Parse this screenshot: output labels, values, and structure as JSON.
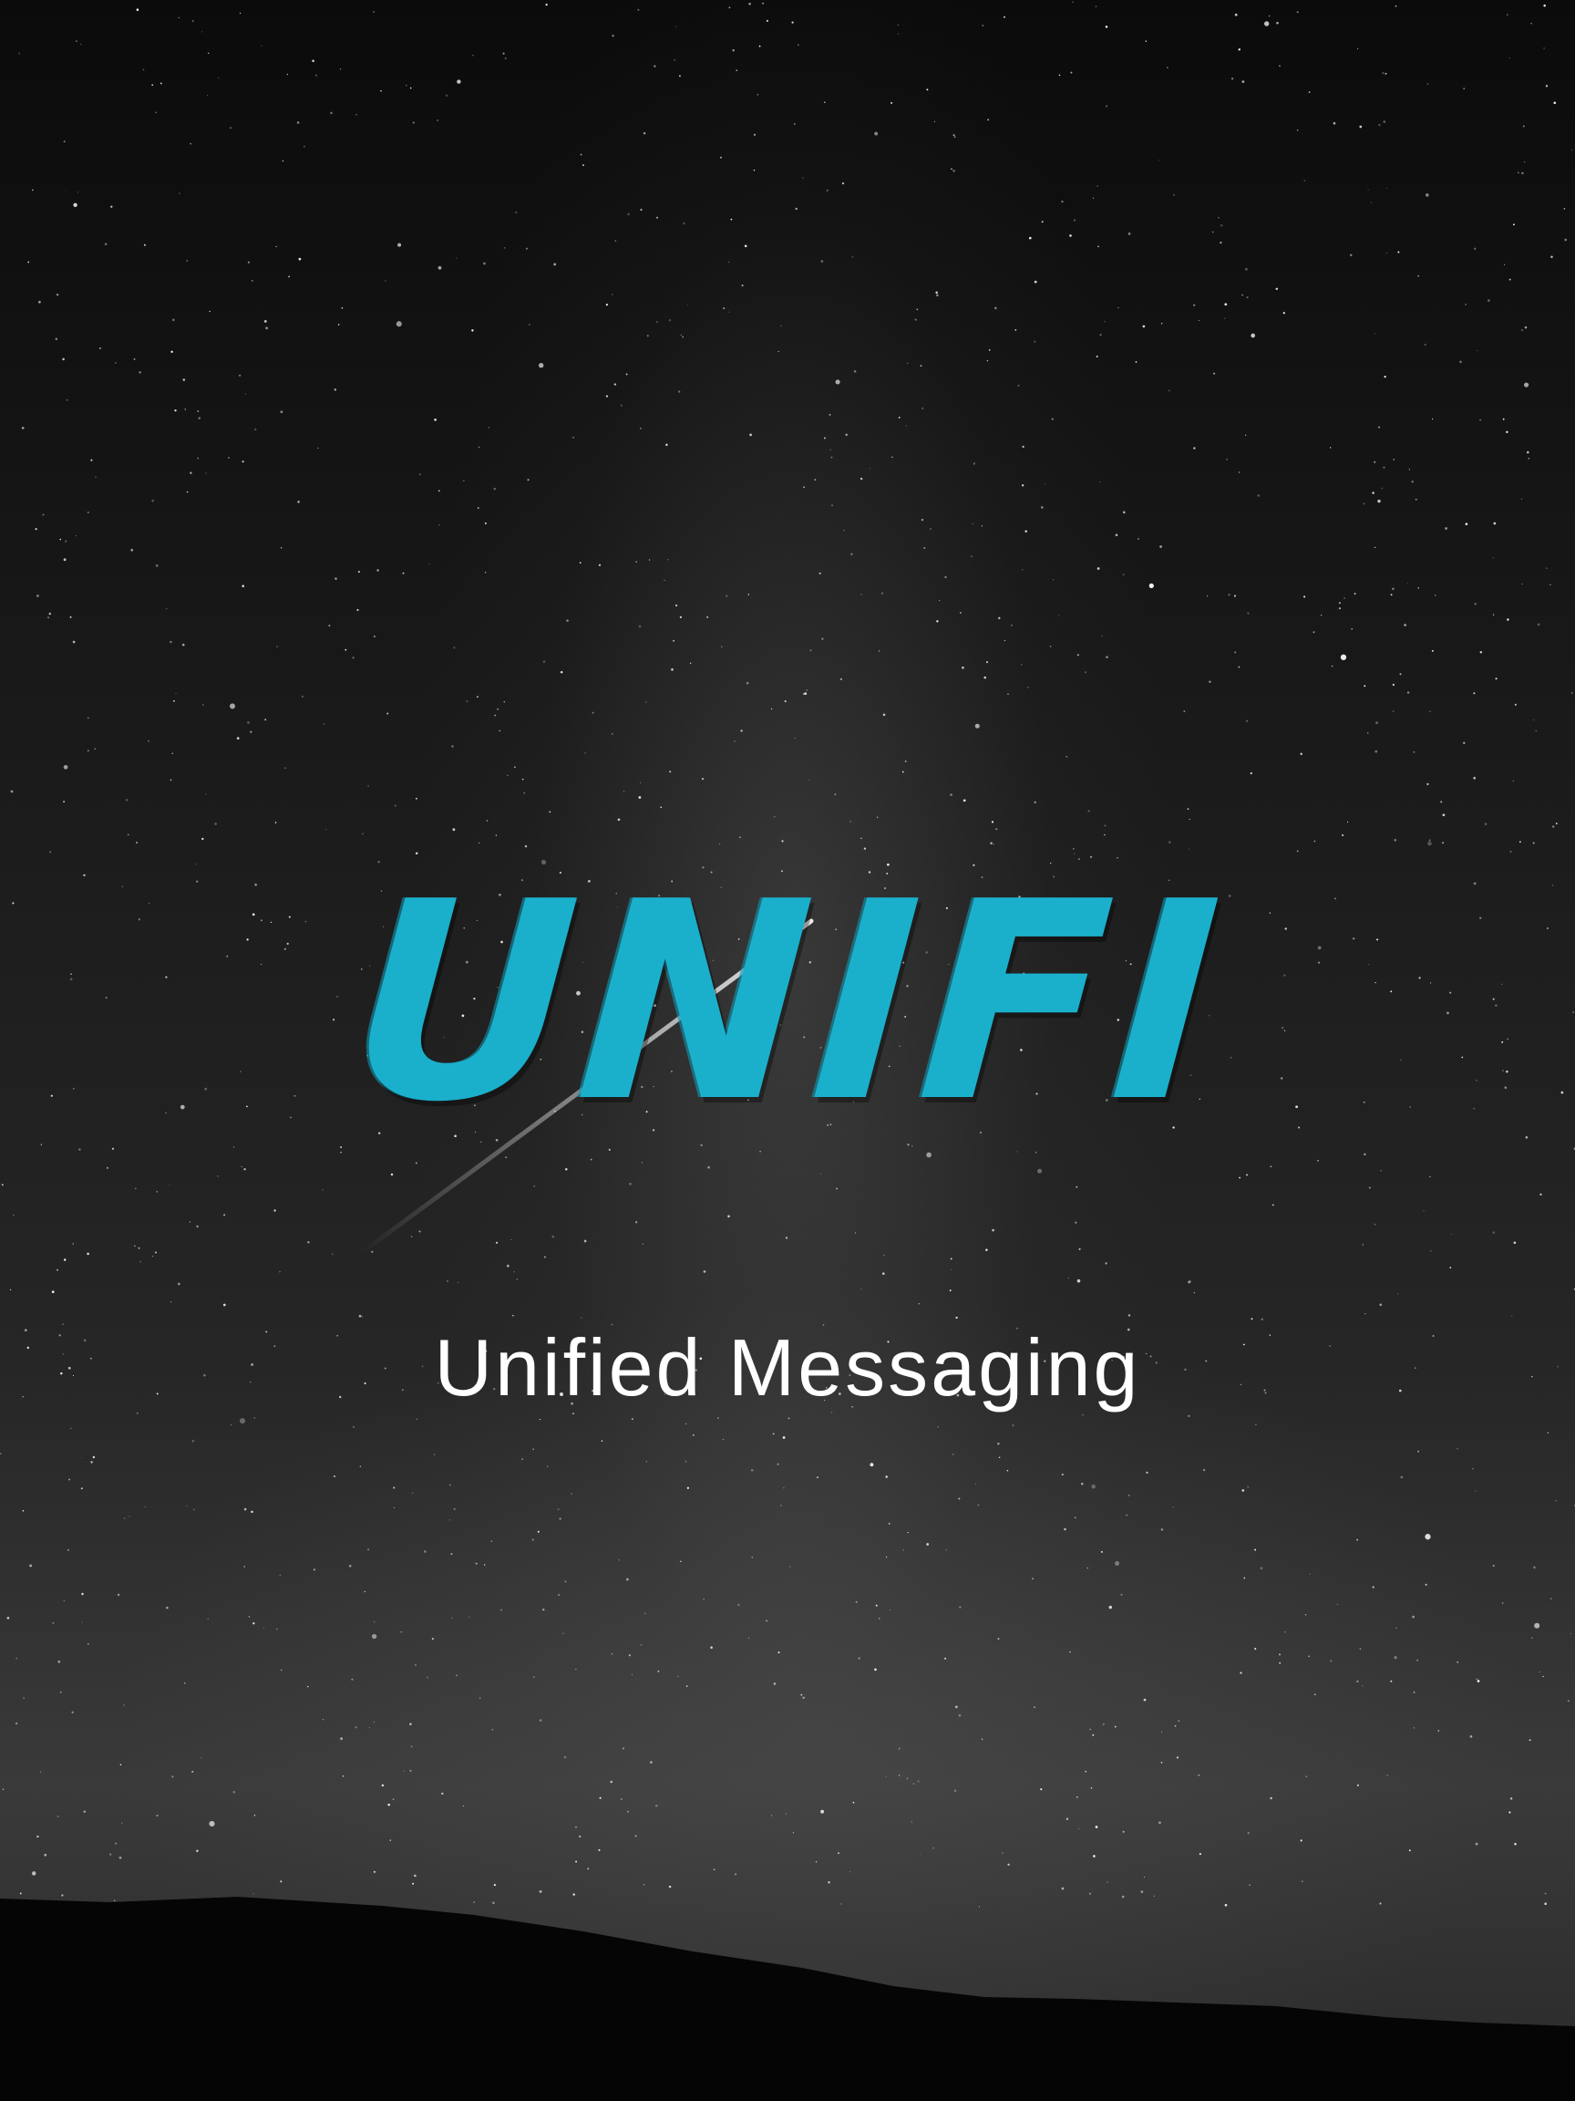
{
  "splash": {
    "logo_text": "UNIFI",
    "tagline": "Unified Messaging"
  },
  "colors": {
    "logo": "#1ab0cc",
    "tagline": "#ffffff",
    "sky_dark": "#0b0b0b",
    "horizon": "#050505"
  },
  "background": {
    "type": "night-sky-with-milky-way",
    "elements": [
      "stars",
      "meteor",
      "mountain-silhouette"
    ]
  }
}
